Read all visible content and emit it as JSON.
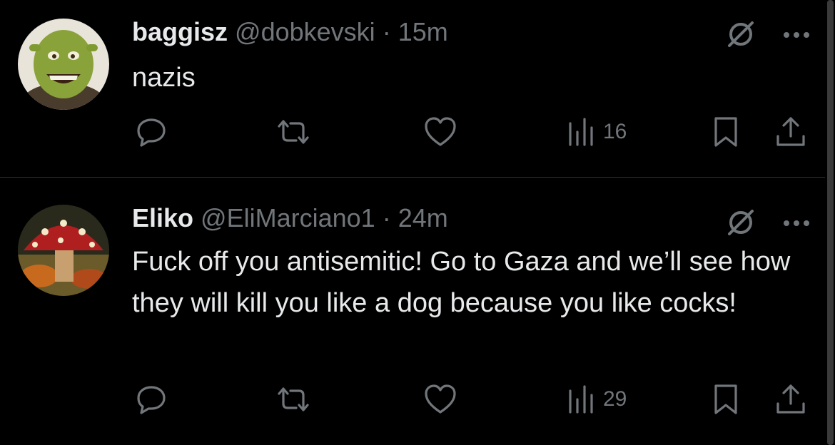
{
  "tweets": [
    {
      "name": "baggisz",
      "handle": "@dobkevski",
      "dot": "·",
      "time": "15m",
      "text": "nazis",
      "views": "16",
      "avatar_icon": "shrek-avatar"
    },
    {
      "name": "Eliko",
      "handle": "@EliMarciano1",
      "dot": "·",
      "time": "24m",
      "text": "Fuck off you antisemitic! Go to Gaza and we’ll see how they will kill you like a dog because you like cocks!",
      "views": "29",
      "avatar_icon": "mushroom-avatar"
    }
  ],
  "colors": {
    "background": "#000000",
    "text": "#e7e9ea",
    "muted": "#71767b",
    "divider": "#2f3336"
  }
}
